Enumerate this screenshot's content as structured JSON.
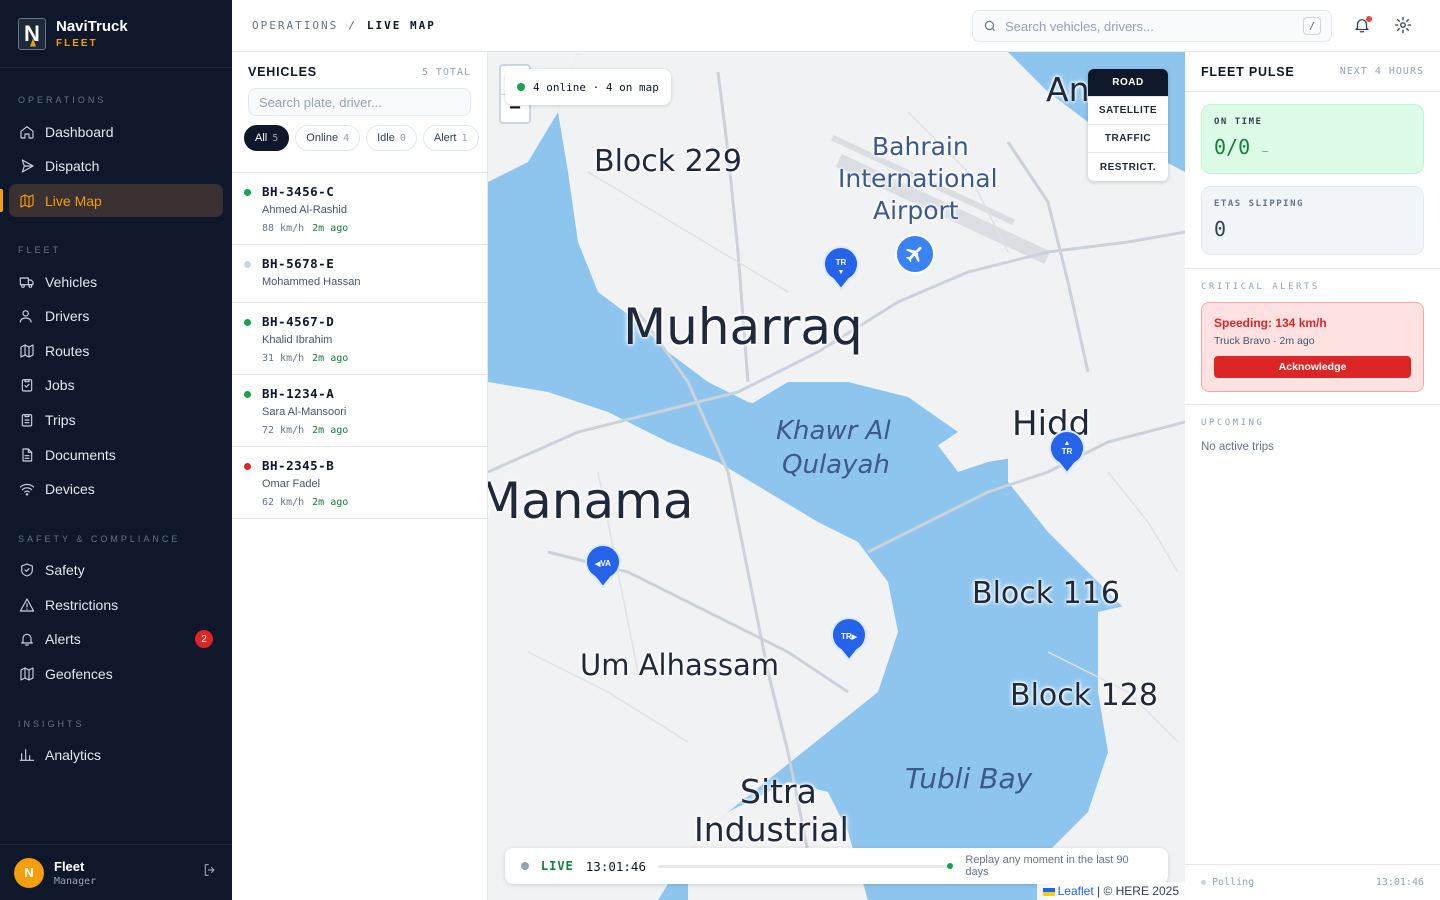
{
  "app": {
    "name": "NaviTruck",
    "sub": "FLEET"
  },
  "sidebar": {
    "sections": [
      "OPERATIONS",
      "FLEET",
      "SAFETY & COMPLIANCE",
      "INSIGHTS"
    ],
    "items": [
      {
        "label": "Dashboard"
      },
      {
        "label": "Dispatch"
      },
      {
        "label": "Live Map"
      },
      {
        "label": "Vehicles"
      },
      {
        "label": "Drivers"
      },
      {
        "label": "Routes"
      },
      {
        "label": "Jobs"
      },
      {
        "label": "Trips"
      },
      {
        "label": "Documents"
      },
      {
        "label": "Devices"
      },
      {
        "label": "Safety"
      },
      {
        "label": "Restrictions"
      },
      {
        "label": "Alerts",
        "badge": "2"
      },
      {
        "label": "Geofences"
      },
      {
        "label": "Analytics"
      }
    ],
    "user": {
      "initial": "N",
      "name": "Fleet",
      "role": "Manager"
    }
  },
  "header": {
    "crumb_parent": "OPERATIONS",
    "crumb_sep": "/",
    "crumb_current": "LIVE MAP",
    "search_placeholder": "Search vehicles, drivers...",
    "search_kbd": "/"
  },
  "vehicles": {
    "title": "VEHICLES",
    "total": "5 TOTAL",
    "search_placeholder": "Search plate, driver...",
    "filters": [
      {
        "label": "All",
        "count": "5"
      },
      {
        "label": "Online",
        "count": "4"
      },
      {
        "label": "Idle",
        "count": "0"
      },
      {
        "label": "Alert",
        "count": "1"
      }
    ],
    "rows": [
      {
        "plate": "BH-3456-C",
        "driver": "Ahmed Al-Rashid",
        "speed": "88 km/h",
        "ago": "2m ago",
        "status_color": "#16a34a"
      },
      {
        "plate": "BH-5678-E",
        "driver": "Mohammed Hassan",
        "speed": "",
        "ago": "",
        "status_color": "#cbd5e1"
      },
      {
        "plate": "BH-4567-D",
        "driver": "Khalid Ibrahim",
        "speed": "31 km/h",
        "ago": "2m ago",
        "status_color": "#16a34a"
      },
      {
        "plate": "BH-1234-A",
        "driver": "Sara Al-Mansoori",
        "speed": "72 km/h",
        "ago": "2m ago",
        "status_color": "#16a34a"
      },
      {
        "plate": "BH-2345-B",
        "driver": "Omar Fadel",
        "speed": "62 km/h",
        "ago": "2m ago",
        "status_color": "#dc2626"
      }
    ]
  },
  "map": {
    "zoom_in": "+",
    "zoom_out": "−",
    "online_text": "4 online · 4 on map",
    "layers": [
      "ROAD",
      "SATELLITE",
      "TRAFFIC",
      "RESTRICT."
    ],
    "labels": {
      "block229": "Block 229",
      "airport1": "Bahrain",
      "airport2": "International",
      "airport3": "Airport",
      "muharraq": "Muharraq",
      "khawr1": "Khawr Al",
      "khawr2": "Qulayah",
      "hidd": "Hidd",
      "manama": "Manama",
      "block116": "Block 116",
      "umalhassam": "Um Alhassam",
      "block128": "Block 128",
      "tubli": "Tubli Bay",
      "sitra1": "Sitra",
      "sitra2": "Industrial",
      "an": "An"
    },
    "pins": [
      {
        "label": "TR",
        "arrow": "▼"
      },
      {
        "label": "TR",
        "arrow": "▲"
      },
      {
        "label": "VA",
        "arrow": "◀"
      },
      {
        "label": "TR",
        "arrow": "▶"
      }
    ],
    "timeline": {
      "live": "LIVE",
      "time": "13:01:46",
      "replay": "Replay any moment in the last 90 days"
    },
    "attribution_link": "Leaflet",
    "attribution_rest": " | © HERE 2025"
  },
  "pulse": {
    "title": "FLEET PULSE",
    "window": "NEXT 4 HOURS",
    "on_time_label": "ON TIME",
    "on_time_value": "0/0",
    "on_time_suffix": "—",
    "etas_label": "ETAS SLIPPING",
    "etas_value": "0",
    "critical_label": "CRITICAL ALERTS",
    "alert_title": "Speeding: 134 km/h",
    "alert_sub": "Truck Bravo · 2m ago",
    "ack_label": "Acknowledge",
    "upcoming_label": "UPCOMING",
    "upcoming_empty": "No active trips",
    "footer_status": "Polling",
    "footer_time": "13:01:46"
  },
  "colors": {
    "accent": "#f59e0b",
    "sidebar_bg": "#0f172a",
    "water": "#8ec5ee",
    "land": "#f1f2f4",
    "pin": "#2563eb",
    "danger": "#dc2626",
    "success": "#16a34a"
  }
}
